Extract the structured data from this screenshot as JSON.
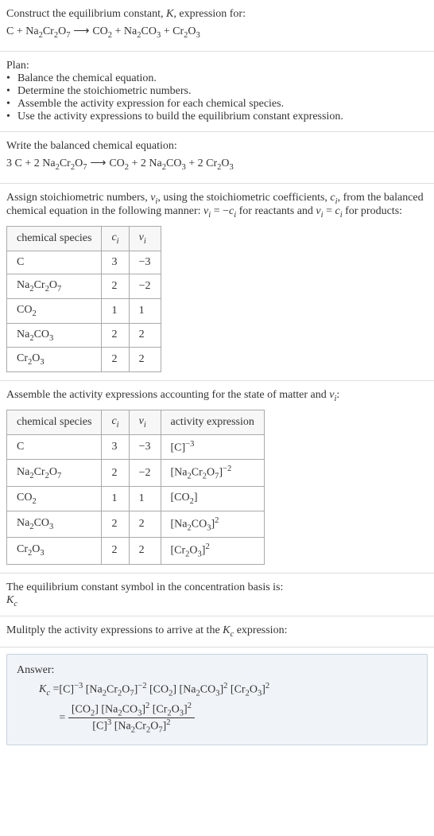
{
  "intro": {
    "line1_a": "Construct the equilibrium constant, ",
    "line1_b": ", expression for:",
    "reaction_unbalanced": {
      "lhs1": "C",
      "plus1": " + ",
      "lhs2_a": "Na",
      "lhs2_sub1": "2",
      "lhs2_b": "Cr",
      "lhs2_sub2": "2",
      "lhs2_c": "O",
      "lhs2_sub3": "7",
      "arrow": " ⟶ ",
      "rhs1_a": "CO",
      "rhs1_sub": "2",
      "plus2": " + ",
      "rhs2_a": "Na",
      "rhs2_sub1": "2",
      "rhs2_b": "CO",
      "rhs2_sub2": "3",
      "plus3": " + ",
      "rhs3_a": "Cr",
      "rhs3_sub1": "2",
      "rhs3_b": "O",
      "rhs3_sub2": "3"
    }
  },
  "plan": {
    "title": "Plan:",
    "bullets": [
      "Balance the chemical equation.",
      "Determine the stoichiometric numbers.",
      "Assemble the activity expression for each chemical species.",
      "Use the activity expressions to build the equilibrium constant expression."
    ]
  },
  "balanced": {
    "title": "Write the balanced chemical equation:",
    "c1": "3 C",
    "plus1": " + ",
    "c2_pre": "2 Na",
    "c2_sub1": "2",
    "c2_mid": "Cr",
    "c2_sub2": "2",
    "c2_end": "O",
    "c2_sub3": "7",
    "arrow": " ⟶ ",
    "p1_pre": "CO",
    "p1_sub": "2",
    "plus2": " + ",
    "p2_pre": "2 Na",
    "p2_sub1": "2",
    "p2_mid": "CO",
    "p2_sub2": "3",
    "plus3": " + ",
    "p3_pre": "2 Cr",
    "p3_sub1": "2",
    "p3_mid": "O",
    "p3_sub2": "3"
  },
  "assign": {
    "text_a": "Assign stoichiometric numbers, ",
    "nu": "ν",
    "i": "i",
    "text_b": ", using the stoichiometric coefficients, ",
    "c": "c",
    "text_c": ", from the balanced chemical equation in the following manner: ",
    "eq1_a": "ν",
    "eq1_b": " = −",
    "eq1_c": "c",
    "text_d": " for reactants and ",
    "eq2_a": "ν",
    "eq2_b": " = ",
    "eq2_c": "c",
    "text_e": " for products:"
  },
  "table1": {
    "headers": {
      "h1": "chemical species",
      "h2_a": "c",
      "h2_b": "i",
      "h3_a": "ν",
      "h3_b": "i"
    },
    "rows": [
      {
        "sp": {
          "t": "C"
        },
        "c": "3",
        "nu": "−3"
      },
      {
        "sp": {
          "a": "Na",
          "s1": "2",
          "b": "Cr",
          "s2": "2",
          "c": "O",
          "s3": "7"
        },
        "c": "2",
        "nu": "−2"
      },
      {
        "sp": {
          "a": "CO",
          "s1": "2"
        },
        "c": "1",
        "nu": "1"
      },
      {
        "sp": {
          "a": "Na",
          "s1": "2",
          "b": "CO",
          "s2": "3"
        },
        "c": "2",
        "nu": "2"
      },
      {
        "sp": {
          "a": "Cr",
          "s1": "2",
          "b": "O",
          "s2": "3"
        },
        "c": "2",
        "nu": "2"
      }
    ]
  },
  "activity_intro": {
    "text_a": "Assemble the activity expressions accounting for the state of matter and ",
    "nu": "ν",
    "i": "i",
    "text_b": ":"
  },
  "table2": {
    "headers": {
      "h1": "chemical species",
      "h2_a": "c",
      "h2_b": "i",
      "h3_a": "ν",
      "h3_b": "i",
      "h4": "activity expression"
    },
    "rows": [
      {
        "sp": {
          "t": "C"
        },
        "c": "3",
        "nu": "−3",
        "ae": {
          "open": "[C]",
          "sup": "−3"
        }
      },
      {
        "sp": {
          "a": "Na",
          "s1": "2",
          "b": "Cr",
          "s2": "2",
          "c": "O",
          "s3": "7"
        },
        "c": "2",
        "nu": "−2",
        "ae": {
          "open": "[Na",
          "s1": "2",
          "mid1": "Cr",
          "s2": "2",
          "mid2": "O",
          "s3": "7",
          "close": "]",
          "sup": "−2"
        }
      },
      {
        "sp": {
          "a": "CO",
          "s1": "2"
        },
        "c": "1",
        "nu": "1",
        "ae": {
          "open": "[CO",
          "s1": "2",
          "close": "]"
        }
      },
      {
        "sp": {
          "a": "Na",
          "s1": "2",
          "b": "CO",
          "s2": "3"
        },
        "c": "2",
        "nu": "2",
        "ae": {
          "open": "[Na",
          "s1": "2",
          "mid1": "CO",
          "s2": "3",
          "close": "]",
          "sup": "2"
        }
      },
      {
        "sp": {
          "a": "Cr",
          "s1": "2",
          "b": "O",
          "s2": "3"
        },
        "c": "2",
        "nu": "2",
        "ae": {
          "open": "[Cr",
          "s1": "2",
          "mid1": "O",
          "s2": "3",
          "close": "]",
          "sup": "2"
        }
      }
    ]
  },
  "eq_sym": {
    "line1": "The equilibrium constant symbol in the concentration basis is:",
    "K": "K",
    "c": "c"
  },
  "multiply": {
    "text_a": "Mulitply the activity expressions to arrive at the ",
    "K": "K",
    "c": "c",
    "text_b": " expression:"
  },
  "answer": {
    "label": "Answer:",
    "K": "K",
    "c": "c",
    "eq": " = ",
    "line1": {
      "p1": "[C]",
      "e1": "−3",
      "sp": " ",
      "p2a": "[Na",
      "p2s1": "2",
      "p2b": "Cr",
      "p2s2": "2",
      "p2c": "O",
      "p2s3": "7",
      "p2d": "]",
      "e2": "−2",
      "p3a": "[CO",
      "p3s1": "2",
      "p3b": "]",
      "p4a": "[Na",
      "p4s1": "2",
      "p4b": "CO",
      "p4s2": "3",
      "p4c": "]",
      "e4": "2",
      "p5a": "[Cr",
      "p5s1": "2",
      "p5b": "O",
      "p5s2": "3",
      "p5c": "]",
      "e5": "2"
    },
    "eq2": " = ",
    "frac": {
      "num": {
        "p1a": "[CO",
        "p1s1": "2",
        "p1b": "]",
        "sp": " ",
        "p2a": "[Na",
        "p2s1": "2",
        "p2b": "CO",
        "p2s2": "3",
        "p2c": "]",
        "e2": "2",
        "p3a": "[Cr",
        "p3s1": "2",
        "p3b": "O",
        "p3s2": "3",
        "p3c": "]",
        "e3": "2"
      },
      "den": {
        "p1": "[C]",
        "e1": "3",
        "sp": " ",
        "p2a": "[Na",
        "p2s1": "2",
        "p2b": "Cr",
        "p2s2": "2",
        "p2c": "O",
        "p2s3": "7",
        "p2d": "]",
        "e2": "2"
      }
    }
  },
  "bullet": "•"
}
